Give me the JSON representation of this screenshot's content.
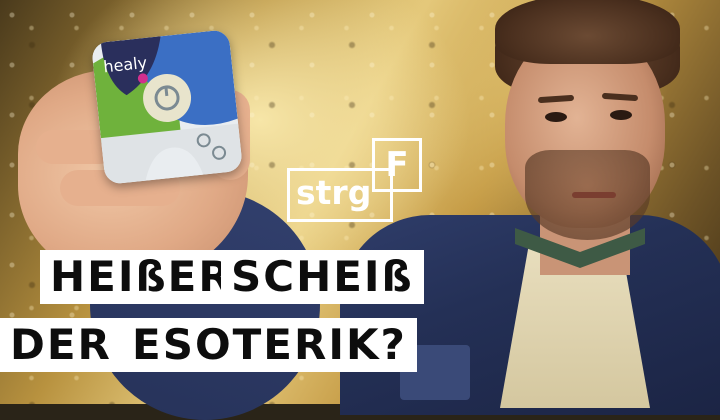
{
  "logo": {
    "word": "strg",
    "key": "F"
  },
  "headline": {
    "line1": [
      "HEIßER",
      "SCHEIß"
    ],
    "line2": [
      "DER",
      "ESOTERIK?"
    ]
  },
  "device": {
    "brand": "healy"
  },
  "colors": {
    "gold": "#d9b866",
    "headline_bg": "#ffffff",
    "headline_text": "#0d0d0d",
    "device_green": "#6fb23c",
    "device_blue": "#3b6fc4"
  }
}
